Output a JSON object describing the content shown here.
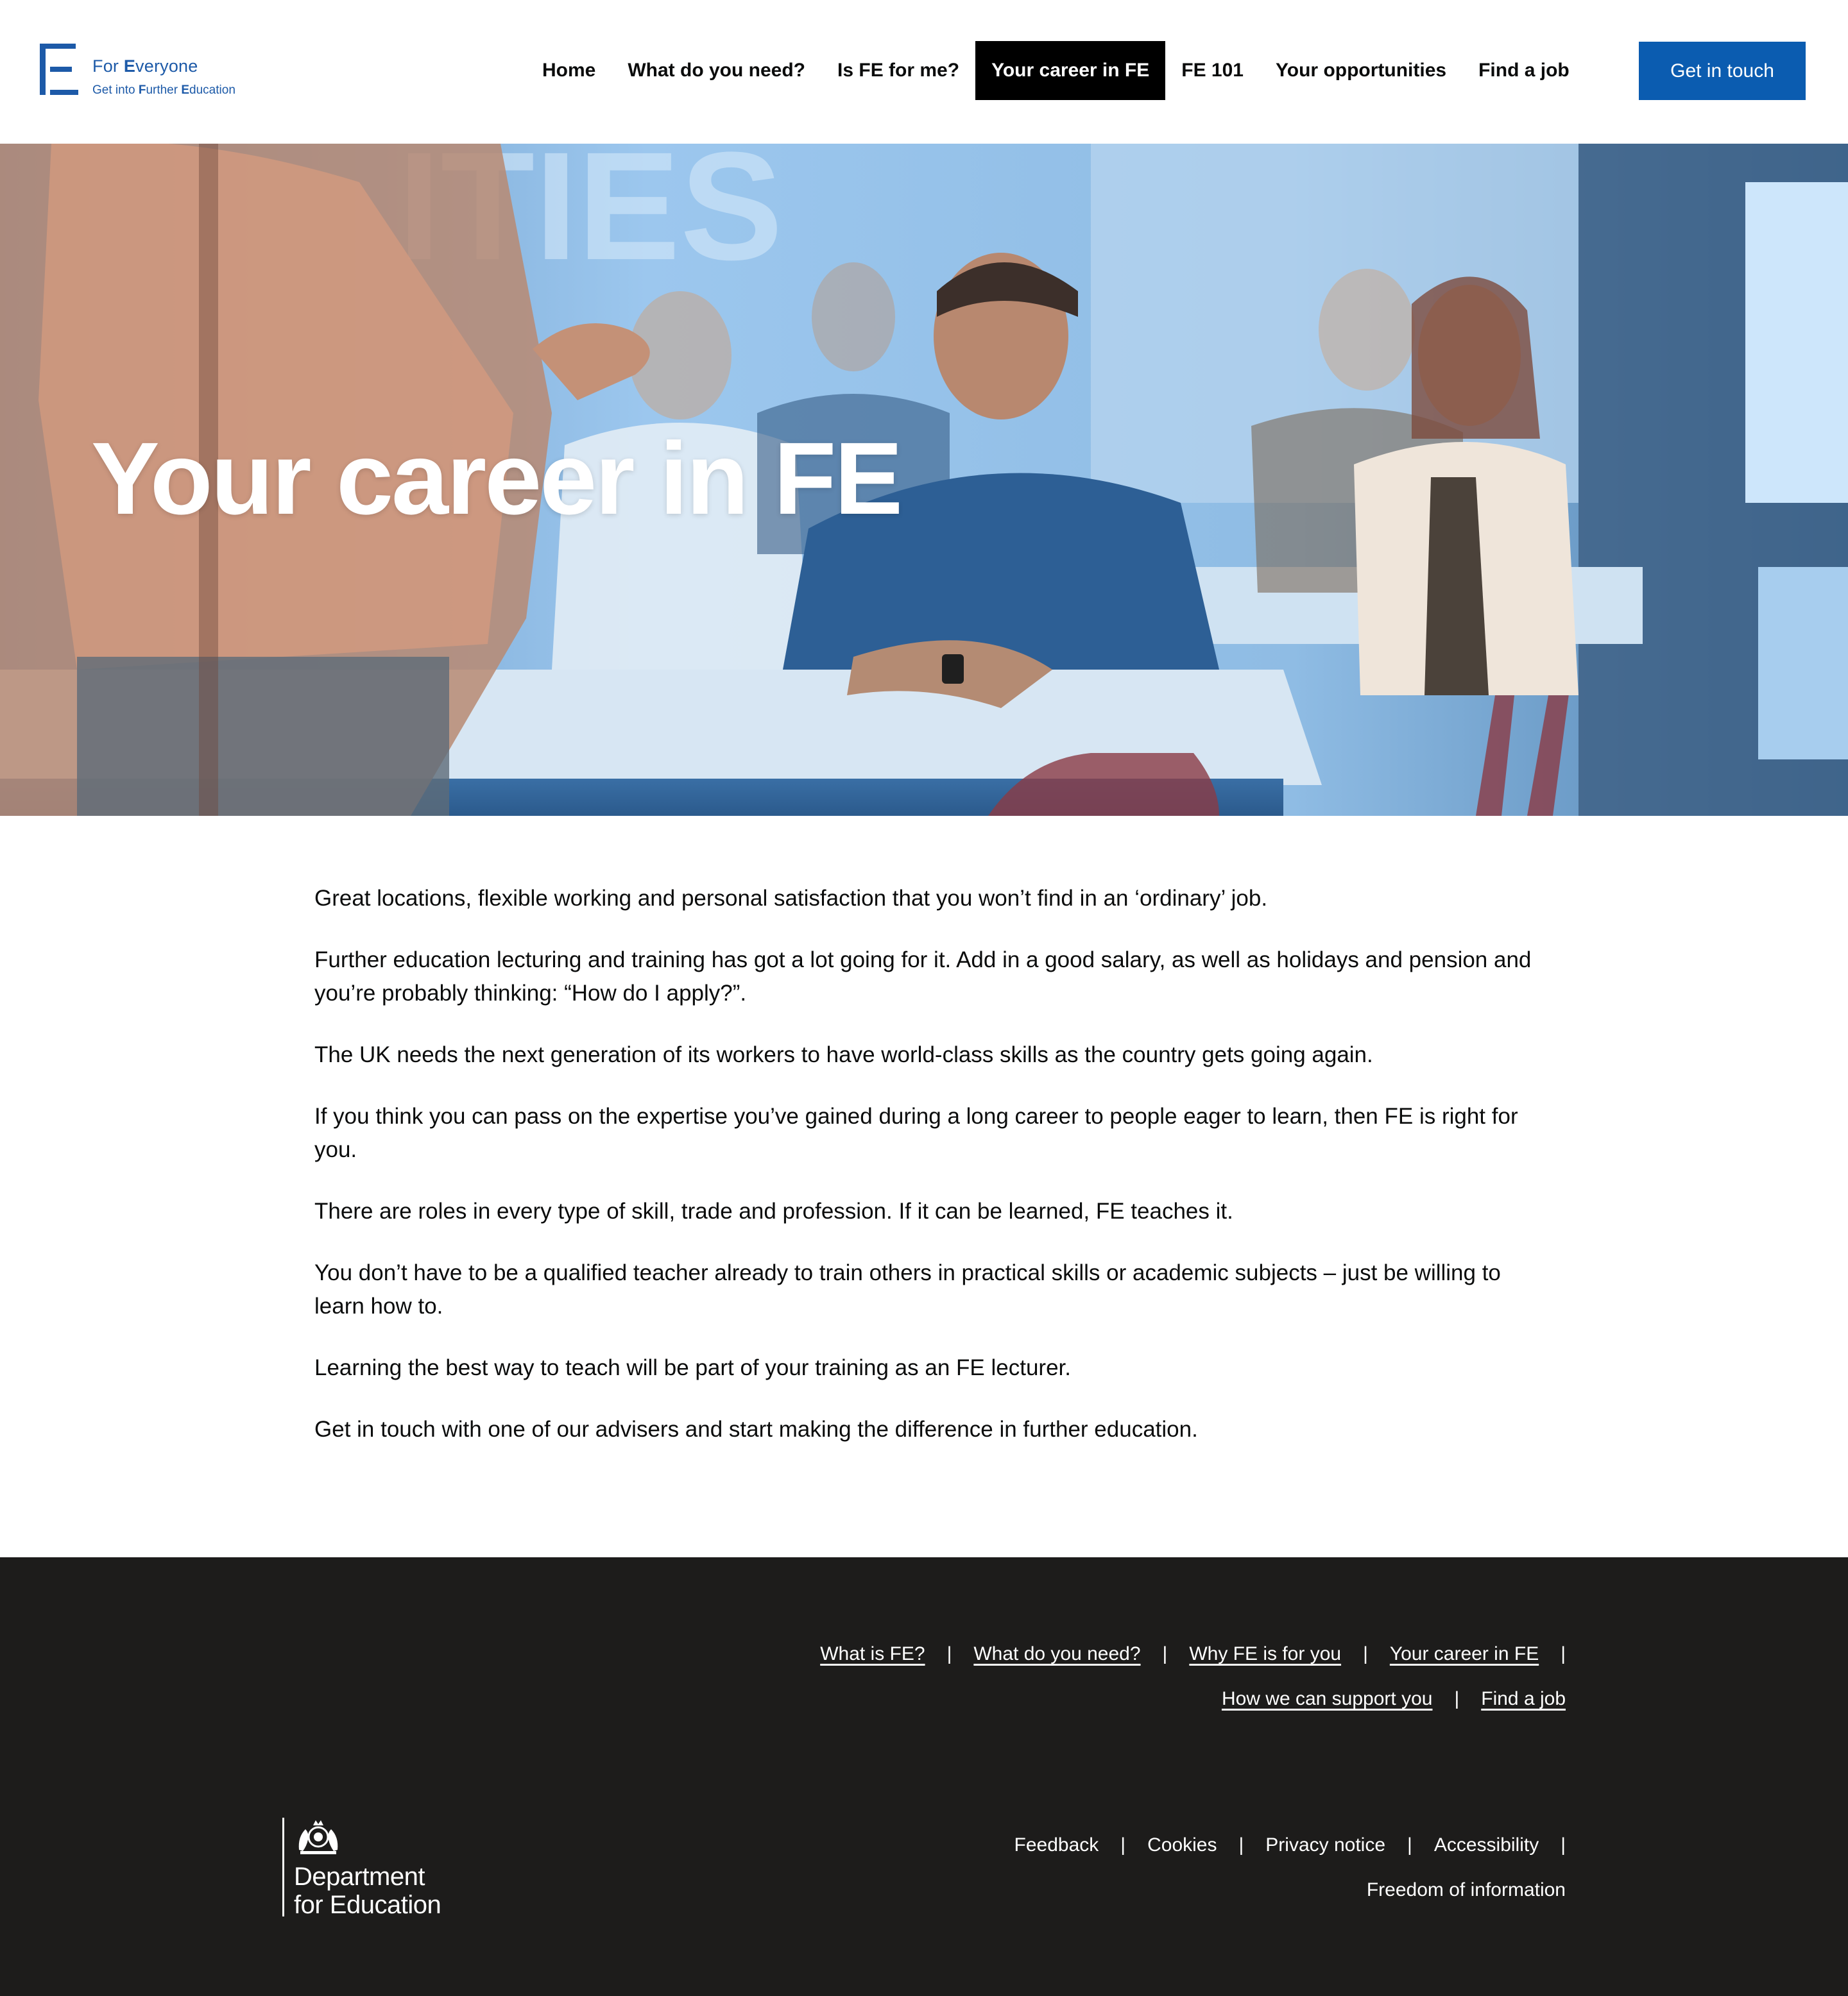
{
  "brand": {
    "title_pre": "For ",
    "title_bold": "E",
    "title_post": "veryone",
    "sub_1": "Get into ",
    "sub_2": "F",
    "sub_3": "urther ",
    "sub_4": "E",
    "sub_5": "ducation",
    "color": "#1d5aa8"
  },
  "nav": {
    "items": [
      {
        "label": "Home",
        "active": false
      },
      {
        "label": "What do you need?",
        "active": false
      },
      {
        "label": "Is FE for me?",
        "active": false
      },
      {
        "label": "Your career in FE",
        "active": true
      },
      {
        "label": "FE 101",
        "active": false
      },
      {
        "label": "Your opportunities",
        "active": false
      },
      {
        "label": "Find a job",
        "active": false
      }
    ],
    "cta_label": "Get in touch",
    "cta_color": "#0b5cb0"
  },
  "hero": {
    "title": "Your career in FE"
  },
  "content": {
    "paragraphs": [
      "Great locations, flexible working and personal satisfaction that you won’t find in an ‘ordinary’ job.",
      "Further education lecturing and training has got a lot going for it. Add in a good salary, as well as holidays and pension and you’re probably thinking: “How do I apply?”.",
      "The UK needs the next generation of its workers to have world-class skills as the country gets going again.",
      "If you think you can pass on the expertise you’ve gained during a long career to people eager to learn, then FE is right for you.",
      "There are roles in every type of skill, trade and profession. If it can be learned, FE teaches it.",
      "You don’t have to be a qualified teacher already to train others in practical skills or academic subjects – just be willing to learn how to.",
      "Learning the best way to teach will be part of your training as an FE lecturer.",
      "Get in touch with one of our advisers and start making the difference in further education."
    ]
  },
  "footer": {
    "nav_row_1": [
      "What is FE?",
      "What do you need?",
      "Why FE is for you",
      "Your career in FE"
    ],
    "nav_row_2": [
      "How we can support you",
      "Find a job"
    ],
    "legal_row_1": [
      "Feedback",
      "Cookies",
      "Privacy notice",
      "Accessibility"
    ],
    "legal_row_2": [
      "Freedom of information"
    ],
    "dfe_line_1": "Department",
    "dfe_line_2": "for Education",
    "background": "#1d1c1b"
  }
}
